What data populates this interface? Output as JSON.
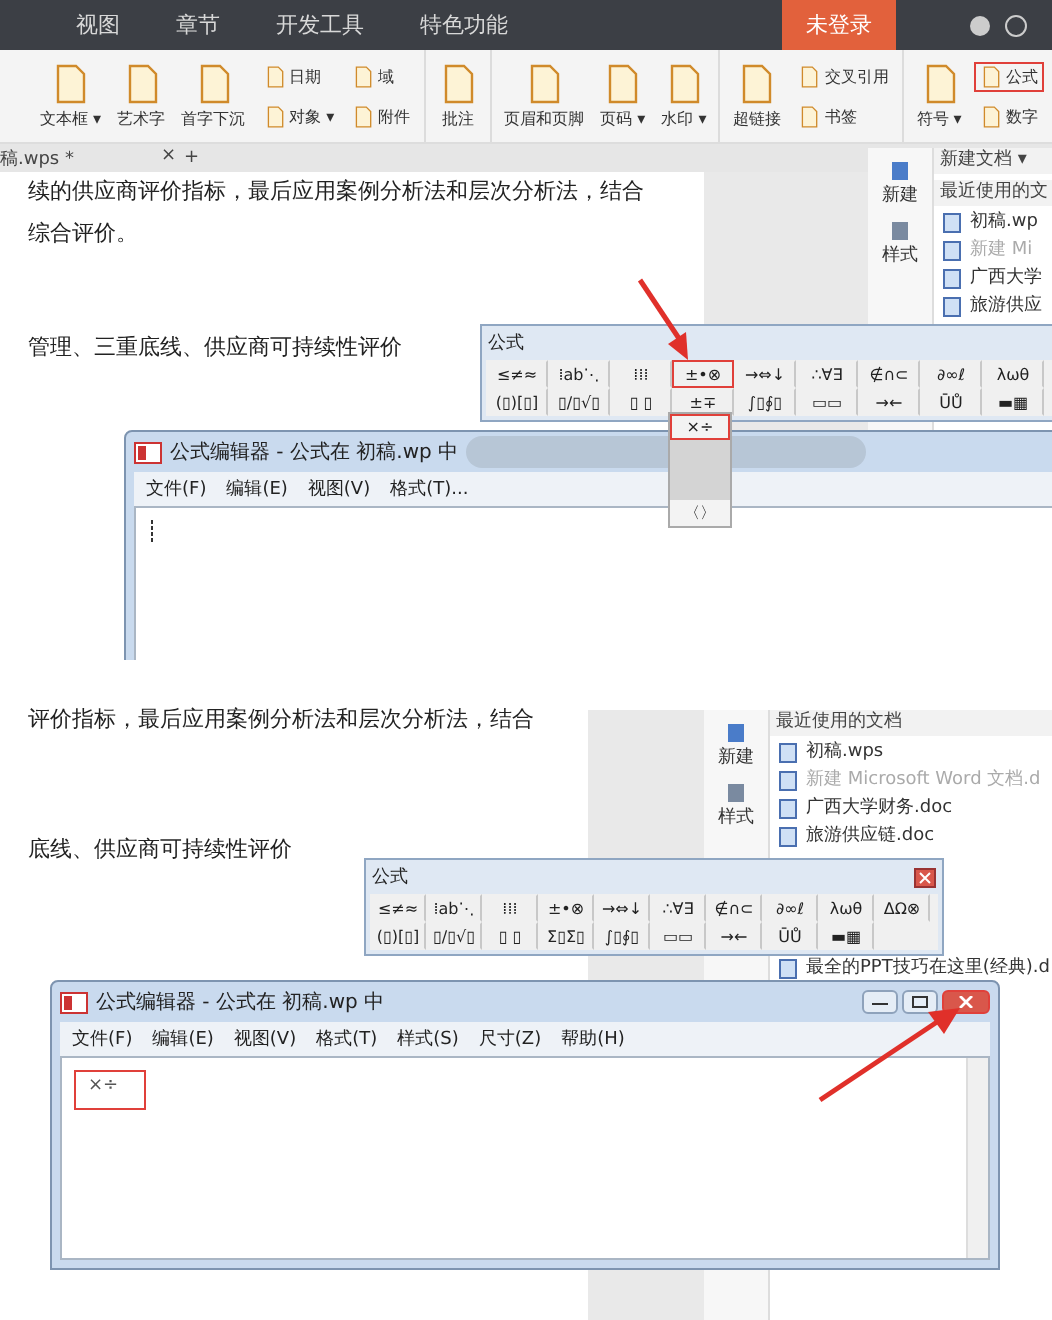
{
  "step1": {
    "ribbon": {
      "tabs": [
        "视图",
        "章节",
        "开发工具",
        "特色功能"
      ],
      "login_button": "未登录",
      "groups": [
        {
          "items": [
            {
              "kind": "large",
              "label": "文本框 ▾",
              "highlighted": false
            },
            {
              "kind": "large",
              "label": "艺术字",
              "highlighted": false
            },
            {
              "kind": "large",
              "label": "首字下沉",
              "highlighted": false
            },
            {
              "kind": "small",
              "label": "日期",
              "highlighted": false
            },
            {
              "kind": "small",
              "label": "对象 ▾",
              "highlighted": false
            },
            {
              "kind": "small",
              "label": "域",
              "highlighted": false
            },
            {
              "kind": "small",
              "label": "附件",
              "highlighted": false
            }
          ]
        },
        {
          "items": [
            {
              "kind": "large",
              "label": "批注",
              "highlighted": false
            }
          ]
        },
        {
          "items": [
            {
              "kind": "large",
              "label": "页眉和页脚",
              "highlighted": false
            },
            {
              "kind": "large",
              "label": "页码 ▾",
              "highlighted": false
            },
            {
              "kind": "large",
              "label": "水印 ▾",
              "highlighted": false
            }
          ]
        },
        {
          "items": [
            {
              "kind": "large",
              "label": "超链接",
              "highlighted": false
            },
            {
              "kind": "small",
              "label": "交叉引用",
              "highlighted": false
            },
            {
              "kind": "small",
              "label": "书签",
              "highlighted": false
            }
          ]
        },
        {
          "items": [
            {
              "kind": "large",
              "label": "符号 ▾",
              "highlighted": false
            },
            {
              "kind": "small",
              "label": "公式",
              "highlighted": true
            },
            {
              "kind": "small",
              "label": "数字",
              "highlighted": false
            }
          ]
        }
      ]
    },
    "doc_tab": {
      "label": "稿.wps *",
      "close": "×",
      "add": "+"
    },
    "document_lines": [
      "续的供应商评价指标，最后应用案例分析法和层次分析法，结合",
      "综合评价。",
      "管理、三重底线、供应商可持续性评价"
    ],
    "sidebar": {
      "header": "新建文档 ▾",
      "subheader": "最近使用的文",
      "buttons": [
        "新建",
        "样式"
      ],
      "files": [
        {
          "name": "初稿.wp",
          "disabled": false
        },
        {
          "name": "新建 Mi",
          "disabled": true
        },
        {
          "name": "广西大学",
          "disabled": false
        },
        {
          "name": "旅游供应",
          "disabled": false
        }
      ]
    },
    "palette": {
      "title": "公式",
      "rows": [
        [
          {
            "symbols": "≤≠≈",
            "highlighted": false
          },
          {
            "symbols": "⁞ab⋱",
            "highlighted": false
          },
          {
            "symbols": "⁞⁞⁞",
            "highlighted": false
          },
          {
            "symbols": "±•⊗",
            "highlighted": true
          },
          {
            "symbols": "→⇔↓",
            "highlighted": false
          },
          {
            "symbols": "∴∀∃",
            "highlighted": false
          },
          {
            "symbols": "∉∩⊂",
            "highlighted": false
          },
          {
            "symbols": "∂∞ℓ",
            "highlighted": false
          },
          {
            "symbols": "λωθ",
            "highlighted": false
          }
        ],
        [
          {
            "symbols": "(▯)[▯]",
            "highlighted": false
          },
          {
            "symbols": "▯/▯√▯",
            "highlighted": false
          },
          {
            "symbols": "▯ ▯",
            "highlighted": false
          },
          {
            "symbols": "±∓",
            "highlighted": false
          },
          {
            "symbols": "∫▯∮▯",
            "highlighted": false
          },
          {
            "symbols": "▭▭",
            "highlighted": false
          },
          {
            "symbols": "→←",
            "highlighted": false
          },
          {
            "symbols": "ŪŮ",
            "highlighted": false
          },
          {
            "symbols": "▬▦",
            "highlighted": false
          }
        ]
      ]
    },
    "dropdown": [
      {
        "symbols": "×÷",
        "highlighted": true
      },
      {
        "symbols": "〈〉",
        "highlighted": false
      }
    ],
    "editor": {
      "title": "公式编辑器 - 公式在 初稿.wp 中",
      "menu": [
        "文件(F)",
        "编辑(E)",
        "视图(V)",
        "格式(T)..."
      ]
    }
  },
  "step2": {
    "document_lines": [
      "评价指标，最后应用案例分析法和层次分析法，结合",
      "底线、供应商可持续性评价"
    ],
    "sidebar": {
      "subheader": "最近使用的文档",
      "buttons": [
        "新建",
        "样式"
      ],
      "files": [
        {
          "name": "初稿.wps",
          "disabled": false
        },
        {
          "name": "新建 Microsoft Word 文档.d",
          "disabled": true
        },
        {
          "name": "广西大学财务.doc",
          "disabled": false
        },
        {
          "name": "旅游供应链.doc",
          "disabled": false
        },
        {
          "name": "最全的PPT技巧在这里(经典).d",
          "disabled": false
        }
      ]
    },
    "palette": {
      "title": "公式",
      "rows": [
        [
          {
            "symbols": "≤≠≈",
            "highlighted": false
          },
          {
            "symbols": "⁞ab⋱",
            "highlighted": false
          },
          {
            "symbols": "⁞⁞⁞",
            "highlighted": false
          },
          {
            "symbols": "±•⊗",
            "highlighted": false
          },
          {
            "symbols": "→⇔↓",
            "highlighted": false
          },
          {
            "symbols": "∴∀∃",
            "highlighted": false
          },
          {
            "symbols": "∉∩⊂",
            "highlighted": false
          },
          {
            "symbols": "∂∞ℓ",
            "highlighted": false
          },
          {
            "symbols": "λωθ",
            "highlighted": false
          },
          {
            "symbols": "ΔΩ⊗",
            "highlighted": false
          }
        ],
        [
          {
            "symbols": "(▯)[▯]",
            "highlighted": false
          },
          {
            "symbols": "▯/▯√▯",
            "highlighted": false
          },
          {
            "symbols": "▯ ▯",
            "highlighted": false
          },
          {
            "symbols": "Σ▯Σ▯",
            "highlighted": false
          },
          {
            "symbols": "∫▯∮▯",
            "highlighted": false
          },
          {
            "symbols": "▭▭",
            "highlighted": false
          },
          {
            "symbols": "→←",
            "highlighted": false
          },
          {
            "symbols": "ŪŮ",
            "highlighted": false
          },
          {
            "symbols": "▬▦",
            "highlighted": false
          }
        ]
      ]
    },
    "editor": {
      "title": "公式编辑器 - 公式在 初稿.wp 中",
      "menu": [
        "文件(F)",
        "编辑(E)",
        "视图(V)",
        "格式(T)",
        "样式(S)",
        "尺寸(Z)",
        "帮助(H)"
      ],
      "content": "×÷",
      "close_highlighted": true
    }
  }
}
